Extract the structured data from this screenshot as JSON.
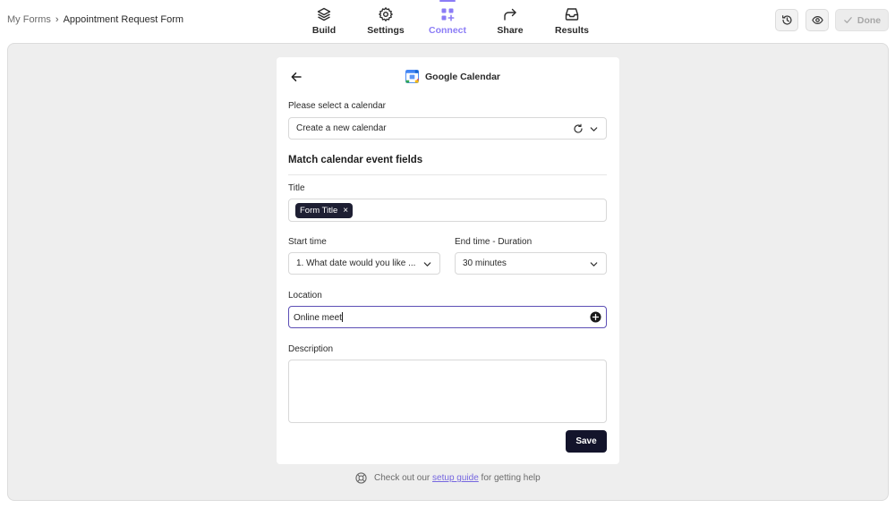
{
  "breadcrumb": {
    "root": "My Forms",
    "separator": "›",
    "current": "Appointment Request Form"
  },
  "nav": {
    "tabs": [
      {
        "label": "Build",
        "icon": "layers-icon"
      },
      {
        "label": "Settings",
        "icon": "gear-icon"
      },
      {
        "label": "Connect",
        "icon": "apps-plus-icon",
        "active": true
      },
      {
        "label": "Share",
        "icon": "share-arrow-icon"
      },
      {
        "label": "Results",
        "icon": "inbox-icon"
      }
    ],
    "active_color": "#8b7cf6"
  },
  "toolbar": {
    "history_icon": "history-icon",
    "preview_icon": "eye-icon",
    "done_label": "Done"
  },
  "integration": {
    "title": "Google Calendar",
    "calendar_label": "Please select a calendar",
    "calendar_value": "Create a new calendar",
    "section_title": "Match calendar event fields",
    "title_label": "Title",
    "title_tag": "Form Title",
    "title_tag_remove": "×",
    "start_label": "Start time",
    "start_value": "1. What date would you like ...",
    "end_label": "End time - Duration",
    "end_value": "30 minutes",
    "location_label": "Location",
    "location_value": "Online meet",
    "description_label": "Description",
    "description_value": "",
    "save_label": "Save"
  },
  "help": {
    "prefix": "Check out our",
    "link": "setup guide",
    "suffix": "for getting help"
  },
  "colors": {
    "accent": "#8b7cf6",
    "primary_button": "#13142b",
    "focus_border": "#5c4fb5",
    "link": "#7566e0"
  }
}
